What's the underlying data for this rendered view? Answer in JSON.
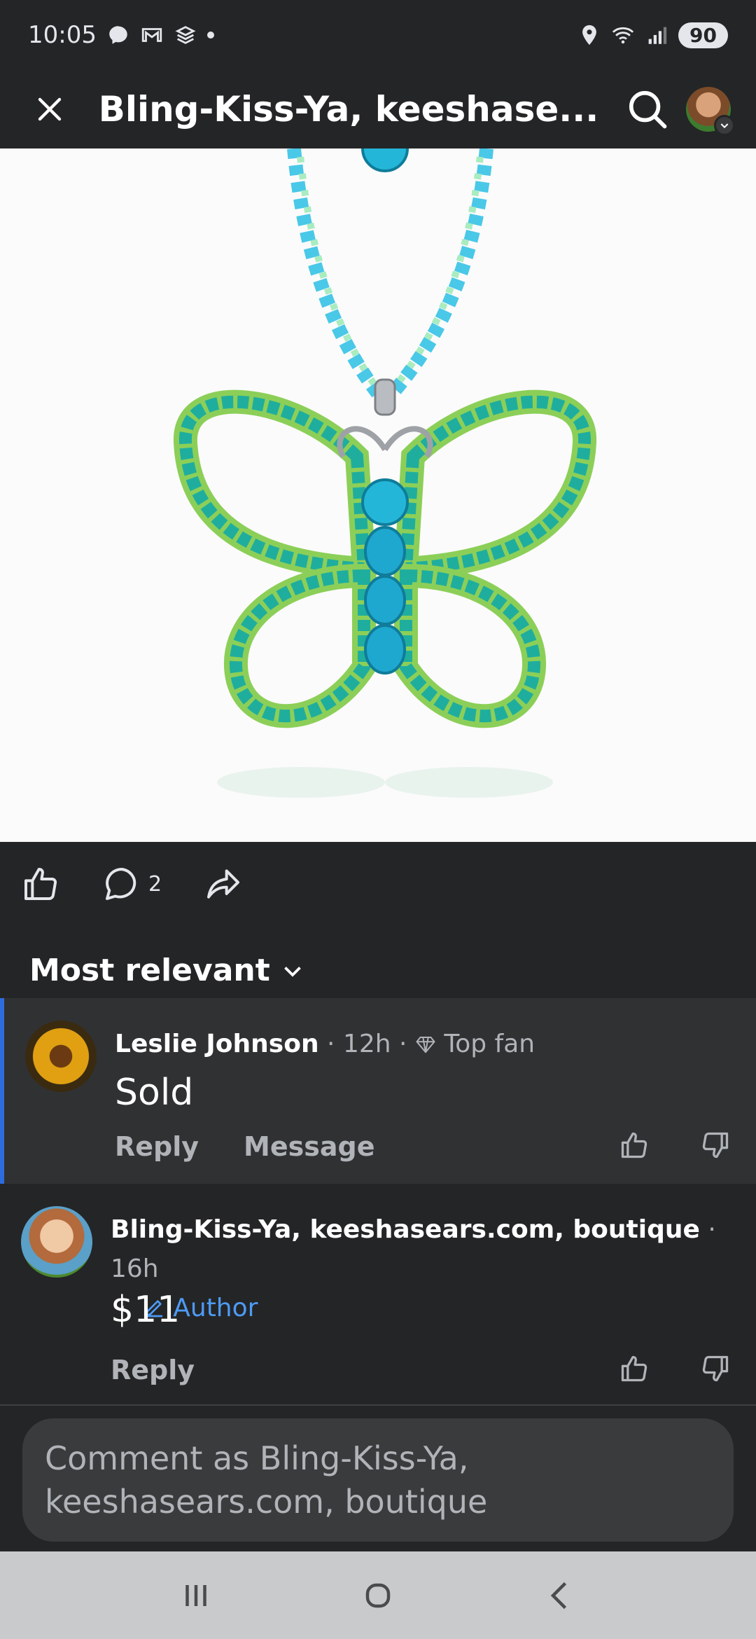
{
  "status_bar": {
    "time": "10:05",
    "battery": "90"
  },
  "header": {
    "title": "Bling-Kiss-Ya, keeshase..."
  },
  "actions": {
    "comment_count": "2"
  },
  "sort": {
    "label": "Most relevant"
  },
  "comments": [
    {
      "name": "Leslie Johnson",
      "time": "12h",
      "badge": "Top fan",
      "text": "Sold",
      "links": [
        "Reply",
        "Message"
      ]
    },
    {
      "name": "Bling-Kiss-Ya, keeshasears.com, boutique",
      "time": "16h",
      "badge": "Author",
      "text": "$11",
      "links": [
        "Reply"
      ]
    }
  ],
  "composer": {
    "placeholder": "Comment as Bling-Kiss-Ya, keeshasears.com, boutique"
  },
  "colors": {
    "accent": "#4d9bf5",
    "background": "#242526",
    "highlight_border": "#2d6cdf"
  }
}
